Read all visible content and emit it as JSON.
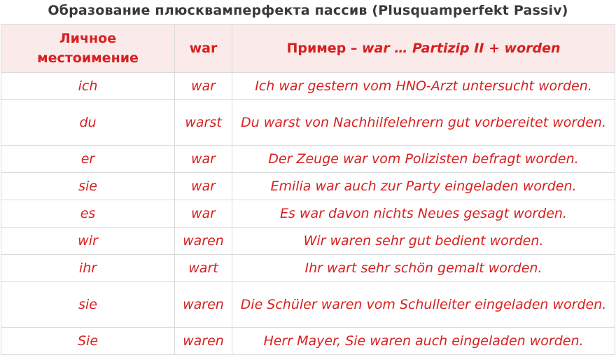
{
  "title": "Образование плюсквамперфекта пассив (Plusquamperfekt Passiv)",
  "table": {
    "headers": {
      "pronoun": "Личное местоимение",
      "aux": "war",
      "example_prefix": "Пример – ",
      "example_formula": "war … Partizip II + worden"
    },
    "rows": [
      {
        "pronoun": "ich",
        "aux": "war",
        "example": "Ich war gestern vom HNO-Arzt untersucht worden."
      },
      {
        "pronoun": "du",
        "aux": "warst",
        "example": "Du warst von Nachhilfelehrern gut vorbereitet worden."
      },
      {
        "pronoun": "er",
        "aux": "war",
        "example": "Der Zeuge war vom Polizisten befragt worden."
      },
      {
        "pronoun": "sie",
        "aux": "war",
        "example": "Emilia war auch zur Party eingeladen worden."
      },
      {
        "pronoun": "es",
        "aux": "war",
        "example": "Es war davon nichts Neues gesagt worden."
      },
      {
        "pronoun": "wir",
        "aux": "waren",
        "example": "Wir waren sehr gut bedient worden."
      },
      {
        "pronoun": "ihr",
        "aux": "wart",
        "example": "Ihr wart sehr schön gemalt worden."
      },
      {
        "pronoun": "sie",
        "aux": "waren",
        "example": "Die Schüler waren vom Schulleiter eingeladen worden."
      },
      {
        "pronoun": "Sie",
        "aux": "waren",
        "example": "Herr Mayer, Sie waren auch eingeladen worden."
      }
    ]
  },
  "colors": {
    "accent": "#d81f1f",
    "title": "#3a3a3a",
    "header_bg": "#faeaea",
    "border": "#d9d9d9"
  }
}
